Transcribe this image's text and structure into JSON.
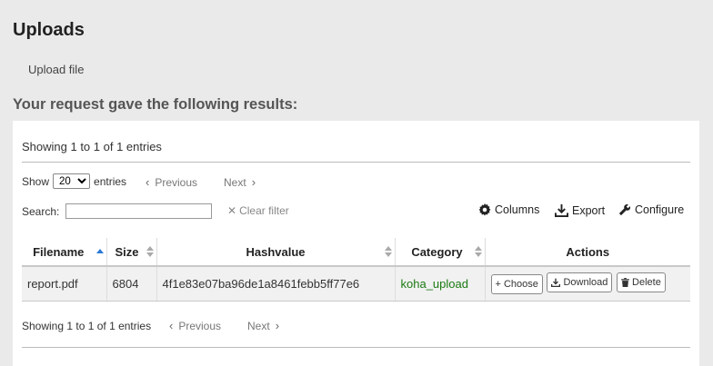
{
  "page": {
    "title": "Uploads",
    "upload_tab": "Upload file",
    "results_heading": "Your request gave the following results:"
  },
  "table_top": {
    "info": "Showing 1 to 1 of 1 entries",
    "show_label": "Show",
    "entries_label": "entries",
    "page_length": "20",
    "page_length_options": [
      "20"
    ],
    "previous": "Previous",
    "next": "Next",
    "search_label": "Search:",
    "search_value": "",
    "clear_filter": "Clear filter",
    "columns": "Columns",
    "export": "Export",
    "configure": "Configure"
  },
  "table": {
    "headers": [
      "Filename",
      "Size",
      "Hashvalue",
      "Category",
      "Actions"
    ],
    "rows": [
      {
        "filename": "report.pdf",
        "size": "6804",
        "hashvalue": "4f1e83e07ba96de1a8461febb5ff77e6",
        "category": "koha_upload",
        "actions": [
          "Choose",
          "Download",
          "Delete"
        ]
      }
    ]
  },
  "table_bottom": {
    "info": "Showing 1 to 1 of 1 entries",
    "previous": "Previous",
    "next": "Next"
  },
  "colors": {
    "category_link": "#1a7a12",
    "sort_active": "#2a7ad5",
    "background": "#eaeaea"
  },
  "icons": {
    "previous": "chevron-left-icon",
    "next": "chevron-right-icon",
    "clear": "x-icon",
    "columns": "gear-icon",
    "export": "download-icon",
    "configure": "wrench-icon",
    "choose": "plus-icon",
    "download": "download-icon",
    "delete": "trash-icon"
  }
}
